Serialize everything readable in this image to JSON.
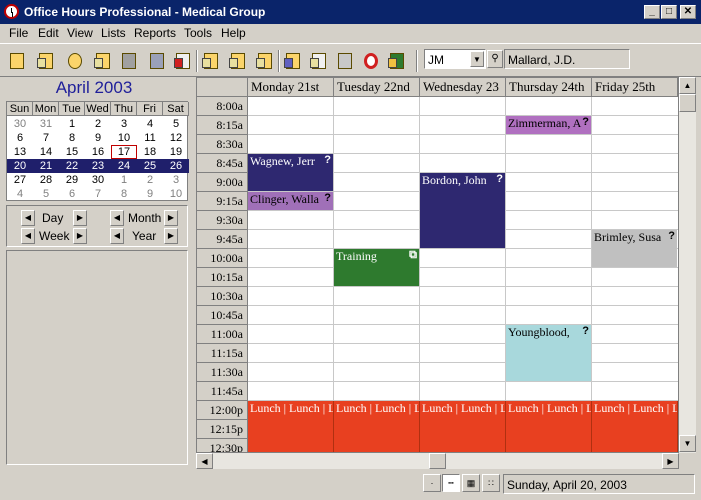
{
  "window": {
    "title": "Office Hours Professional - Medical Group"
  },
  "menu": [
    "File",
    "Edit",
    "View",
    "Lists",
    "Reports",
    "Tools",
    "Help"
  ],
  "toolbar": {
    "user_code": "JM",
    "user_name": "Mallard, J.D.",
    "buttons": [
      "appointment-icon",
      "new-appointment-icon",
      "alarm-icon",
      "schedule-icon",
      "patient-icon",
      "books-icon",
      "medical-record-icon",
      "notes-icon",
      "edit-icon",
      "tools-icon",
      "reports-icon",
      "documents-icon",
      "print-icon",
      "help-icon",
      "exit-icon"
    ]
  },
  "mini_calendar": {
    "month_title": "April 2003",
    "day_headers": [
      "Sun",
      "Mon",
      "Tue",
      "Wed",
      "Thu",
      "Fri",
      "Sat"
    ],
    "weeks": [
      [
        "30",
        "31",
        "1",
        "2",
        "3",
        "4",
        "5"
      ],
      [
        "6",
        "7",
        "8",
        "9",
        "10",
        "11",
        "12"
      ],
      [
        "13",
        "14",
        "15",
        "16",
        "17",
        "18",
        "19"
      ],
      [
        "20",
        "21",
        "22",
        "23",
        "24",
        "25",
        "26"
      ],
      [
        "27",
        "28",
        "29",
        "30",
        "1",
        "2",
        "3"
      ],
      [
        "4",
        "5",
        "6",
        "7",
        "8",
        "9",
        "10"
      ]
    ],
    "today": "17",
    "selected_week_index": 3
  },
  "nav": {
    "day": "Day",
    "week": "Week",
    "month": "Month",
    "year": "Year"
  },
  "schedule": {
    "days": [
      "Monday 21st",
      "Tuesday 22nd",
      "Wednesday 23",
      "Thursday 24th",
      "Friday 25th"
    ],
    "times": [
      "8:00a",
      "8:15a",
      "8:30a",
      "8:45a",
      "9:00a",
      "9:15a",
      "9:30a",
      "9:45a",
      "10:00a",
      "10:15a",
      "10:30a",
      "10:45a",
      "11:00a",
      "11:15a",
      "11:30a",
      "11:45a",
      "12:00p",
      "12:15p",
      "12:30p"
    ],
    "appointments": [
      {
        "label": "Wagnew, Jerr",
        "mark": "?",
        "color": "#2e2870",
        "text_color": "#ffffff",
        "day": 0,
        "start": 3,
        "slots": 2
      },
      {
        "label": "Clinger, Walla",
        "mark": "?",
        "color": "#a070b8",
        "text_color": "#000000",
        "day": 0,
        "start": 5,
        "slots": 1
      },
      {
        "label": "Training",
        "mark": "⧉",
        "color": "#2e7a2e",
        "text_color": "#ffffff",
        "day": 1,
        "start": 8,
        "slots": 2
      },
      {
        "label": "Bordon, John",
        "mark": "?",
        "color": "#2e2870",
        "text_color": "#ffffff",
        "day": 2,
        "start": 4,
        "slots": 4
      },
      {
        "label": "Zimmerman, A",
        "mark": "?",
        "color": "#b070c0",
        "text_color": "#000000",
        "day": 3,
        "start": 1,
        "slots": 1
      },
      {
        "label": "Youngblood,",
        "mark": "?",
        "color": "#a8d8dc",
        "text_color": "#000000",
        "day": 3,
        "start": 12,
        "slots": 3
      },
      {
        "label": "Brimley, Susa",
        "mark": "?",
        "color": "#c0c0c0",
        "text_color": "#000000",
        "day": 4,
        "start": 7,
        "slots": 2
      }
    ],
    "lunch_label": "Lunch | Lunch | Lunch",
    "lunch_start": 16,
    "lunch_color": "#e84020"
  },
  "status": {
    "date": "Sunday, April 20, 2003"
  }
}
